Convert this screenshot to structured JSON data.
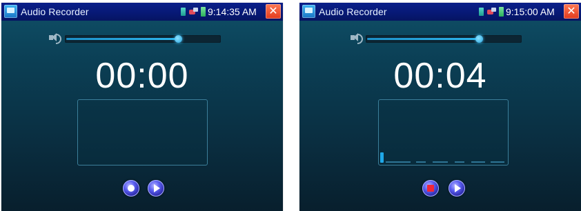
{
  "screens": [
    {
      "app_title": "Audio Recorder",
      "clock": "9:14:35 AM",
      "timer": "00:00",
      "volume_level": 0.73,
      "state": "idle",
      "primary_control": "record-icon",
      "secondary_control": "play-icon"
    },
    {
      "app_title": "Audio Recorder",
      "clock": "9:15:00 AM",
      "timer": "00:04",
      "volume_level": 0.73,
      "state": "recording",
      "primary_control": "stop-icon",
      "secondary_control": "play-icon"
    }
  ],
  "colors": {
    "statusbar": "#071976",
    "accent": "#1fa8e8",
    "close_button": "#e23a1d",
    "stop": "#f0273a",
    "timer_text": "#ffffff"
  }
}
